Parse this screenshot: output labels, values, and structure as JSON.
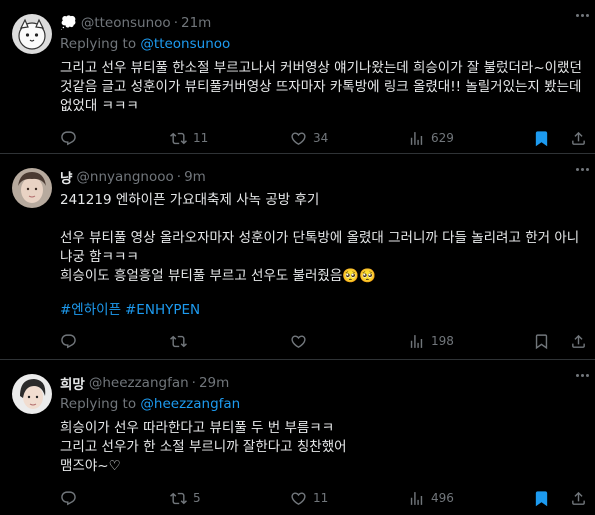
{
  "colors": {
    "background": "#000000",
    "text": "#e7e9ea",
    "muted": "#71767b",
    "link": "#1d9bf0",
    "bookmark": "#1d9bf0",
    "divider": "#2f3336"
  },
  "tweets": [
    {
      "name": "",
      "name_emoji": "💭",
      "handle": "@tteonsunoo",
      "separator": "·",
      "time": "21m",
      "replying_prefix": "Replying to ",
      "replying_to": "@tteonsunoo",
      "text": "그리고 선우 뷰티풀 한소절 부르고나서 커버영상 얘기나왔는데 희승이가 잘 불렀더라~이랬던것같음 글고 성훈이가 뷰티풀커버영상 뜨자마자 카톡방에 링크 올렸대!! 놀릴거있는지 봤는데 없었대 ㅋㅋㅋ",
      "reply_count": "",
      "retweet_count": "11",
      "like_count": "34",
      "view_count": "629",
      "bookmarked": true
    },
    {
      "name": "냥",
      "handle": "@nnyangnooo",
      "separator": "·",
      "time": "9m",
      "text": "241219 엔하이픈 가요대축제 사녹 공방 후기\n\n선우 뷰티풀 영상 올라오자마자 성훈이가 단톡방에 올렸대 그러니까 다들 놀리려고 한거 아니냐궁 함ㅋㅋㅋ\n희승이도 흥얼흥얼 뷰티풀 부르고 선우도 불러줬음🥺🥺",
      "hashtags": [
        "#엔하이픈",
        "#ENHYPEN"
      ],
      "reply_count": "",
      "retweet_count": "",
      "like_count": "",
      "view_count": "198",
      "bookmarked": false
    },
    {
      "name": "희망",
      "handle": "@heezzangfan",
      "separator": "·",
      "time": "29m",
      "replying_prefix": "Replying to ",
      "replying_to": "@heezzangfan",
      "text": "희승이가 선우 따라한다고 뷰티풀 두 번 부름ㅋㅋ\n그리고 선우가 한 소절 부르니까 잘한다고 칭찬했어\n맴즈야~♡",
      "reply_count": "",
      "retweet_count": "5",
      "like_count": "11",
      "view_count": "496",
      "bookmarked": true
    }
  ]
}
